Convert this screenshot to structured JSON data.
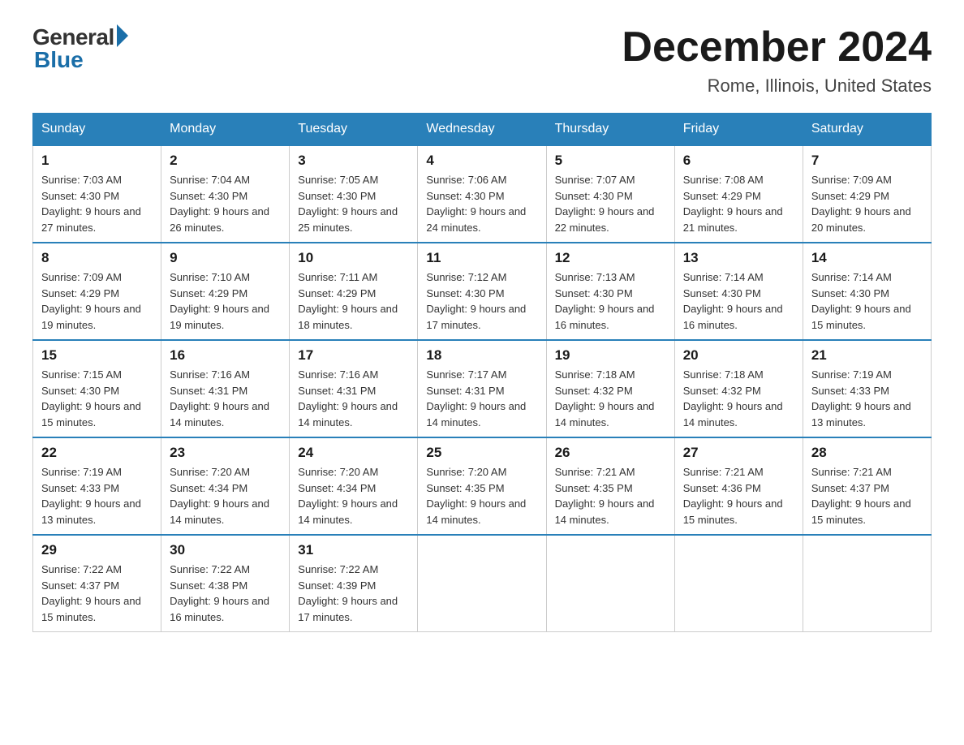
{
  "header": {
    "logo_general": "General",
    "logo_blue": "Blue",
    "title": "December 2024",
    "location": "Rome, Illinois, United States"
  },
  "days_of_week": [
    "Sunday",
    "Monday",
    "Tuesday",
    "Wednesday",
    "Thursday",
    "Friday",
    "Saturday"
  ],
  "weeks": [
    [
      {
        "day": "1",
        "sunrise": "7:03 AM",
        "sunset": "4:30 PM",
        "daylight": "9 hours and 27 minutes."
      },
      {
        "day": "2",
        "sunrise": "7:04 AM",
        "sunset": "4:30 PM",
        "daylight": "9 hours and 26 minutes."
      },
      {
        "day": "3",
        "sunrise": "7:05 AM",
        "sunset": "4:30 PM",
        "daylight": "9 hours and 25 minutes."
      },
      {
        "day": "4",
        "sunrise": "7:06 AM",
        "sunset": "4:30 PM",
        "daylight": "9 hours and 24 minutes."
      },
      {
        "day": "5",
        "sunrise": "7:07 AM",
        "sunset": "4:30 PM",
        "daylight": "9 hours and 22 minutes."
      },
      {
        "day": "6",
        "sunrise": "7:08 AM",
        "sunset": "4:29 PM",
        "daylight": "9 hours and 21 minutes."
      },
      {
        "day": "7",
        "sunrise": "7:09 AM",
        "sunset": "4:29 PM",
        "daylight": "9 hours and 20 minutes."
      }
    ],
    [
      {
        "day": "8",
        "sunrise": "7:09 AM",
        "sunset": "4:29 PM",
        "daylight": "9 hours and 19 minutes."
      },
      {
        "day": "9",
        "sunrise": "7:10 AM",
        "sunset": "4:29 PM",
        "daylight": "9 hours and 19 minutes."
      },
      {
        "day": "10",
        "sunrise": "7:11 AM",
        "sunset": "4:29 PM",
        "daylight": "9 hours and 18 minutes."
      },
      {
        "day": "11",
        "sunrise": "7:12 AM",
        "sunset": "4:30 PM",
        "daylight": "9 hours and 17 minutes."
      },
      {
        "day": "12",
        "sunrise": "7:13 AM",
        "sunset": "4:30 PM",
        "daylight": "9 hours and 16 minutes."
      },
      {
        "day": "13",
        "sunrise": "7:14 AM",
        "sunset": "4:30 PM",
        "daylight": "9 hours and 16 minutes."
      },
      {
        "day": "14",
        "sunrise": "7:14 AM",
        "sunset": "4:30 PM",
        "daylight": "9 hours and 15 minutes."
      }
    ],
    [
      {
        "day": "15",
        "sunrise": "7:15 AM",
        "sunset": "4:30 PM",
        "daylight": "9 hours and 15 minutes."
      },
      {
        "day": "16",
        "sunrise": "7:16 AM",
        "sunset": "4:31 PM",
        "daylight": "9 hours and 14 minutes."
      },
      {
        "day": "17",
        "sunrise": "7:16 AM",
        "sunset": "4:31 PM",
        "daylight": "9 hours and 14 minutes."
      },
      {
        "day": "18",
        "sunrise": "7:17 AM",
        "sunset": "4:31 PM",
        "daylight": "9 hours and 14 minutes."
      },
      {
        "day": "19",
        "sunrise": "7:18 AM",
        "sunset": "4:32 PM",
        "daylight": "9 hours and 14 minutes."
      },
      {
        "day": "20",
        "sunrise": "7:18 AM",
        "sunset": "4:32 PM",
        "daylight": "9 hours and 14 minutes."
      },
      {
        "day": "21",
        "sunrise": "7:19 AM",
        "sunset": "4:33 PM",
        "daylight": "9 hours and 13 minutes."
      }
    ],
    [
      {
        "day": "22",
        "sunrise": "7:19 AM",
        "sunset": "4:33 PM",
        "daylight": "9 hours and 13 minutes."
      },
      {
        "day": "23",
        "sunrise": "7:20 AM",
        "sunset": "4:34 PM",
        "daylight": "9 hours and 14 minutes."
      },
      {
        "day": "24",
        "sunrise": "7:20 AM",
        "sunset": "4:34 PM",
        "daylight": "9 hours and 14 minutes."
      },
      {
        "day": "25",
        "sunrise": "7:20 AM",
        "sunset": "4:35 PM",
        "daylight": "9 hours and 14 minutes."
      },
      {
        "day": "26",
        "sunrise": "7:21 AM",
        "sunset": "4:35 PM",
        "daylight": "9 hours and 14 minutes."
      },
      {
        "day": "27",
        "sunrise": "7:21 AM",
        "sunset": "4:36 PM",
        "daylight": "9 hours and 15 minutes."
      },
      {
        "day": "28",
        "sunrise": "7:21 AM",
        "sunset": "4:37 PM",
        "daylight": "9 hours and 15 minutes."
      }
    ],
    [
      {
        "day": "29",
        "sunrise": "7:22 AM",
        "sunset": "4:37 PM",
        "daylight": "9 hours and 15 minutes."
      },
      {
        "day": "30",
        "sunrise": "7:22 AM",
        "sunset": "4:38 PM",
        "daylight": "9 hours and 16 minutes."
      },
      {
        "day": "31",
        "sunrise": "7:22 AM",
        "sunset": "4:39 PM",
        "daylight": "9 hours and 17 minutes."
      },
      null,
      null,
      null,
      null
    ]
  ]
}
